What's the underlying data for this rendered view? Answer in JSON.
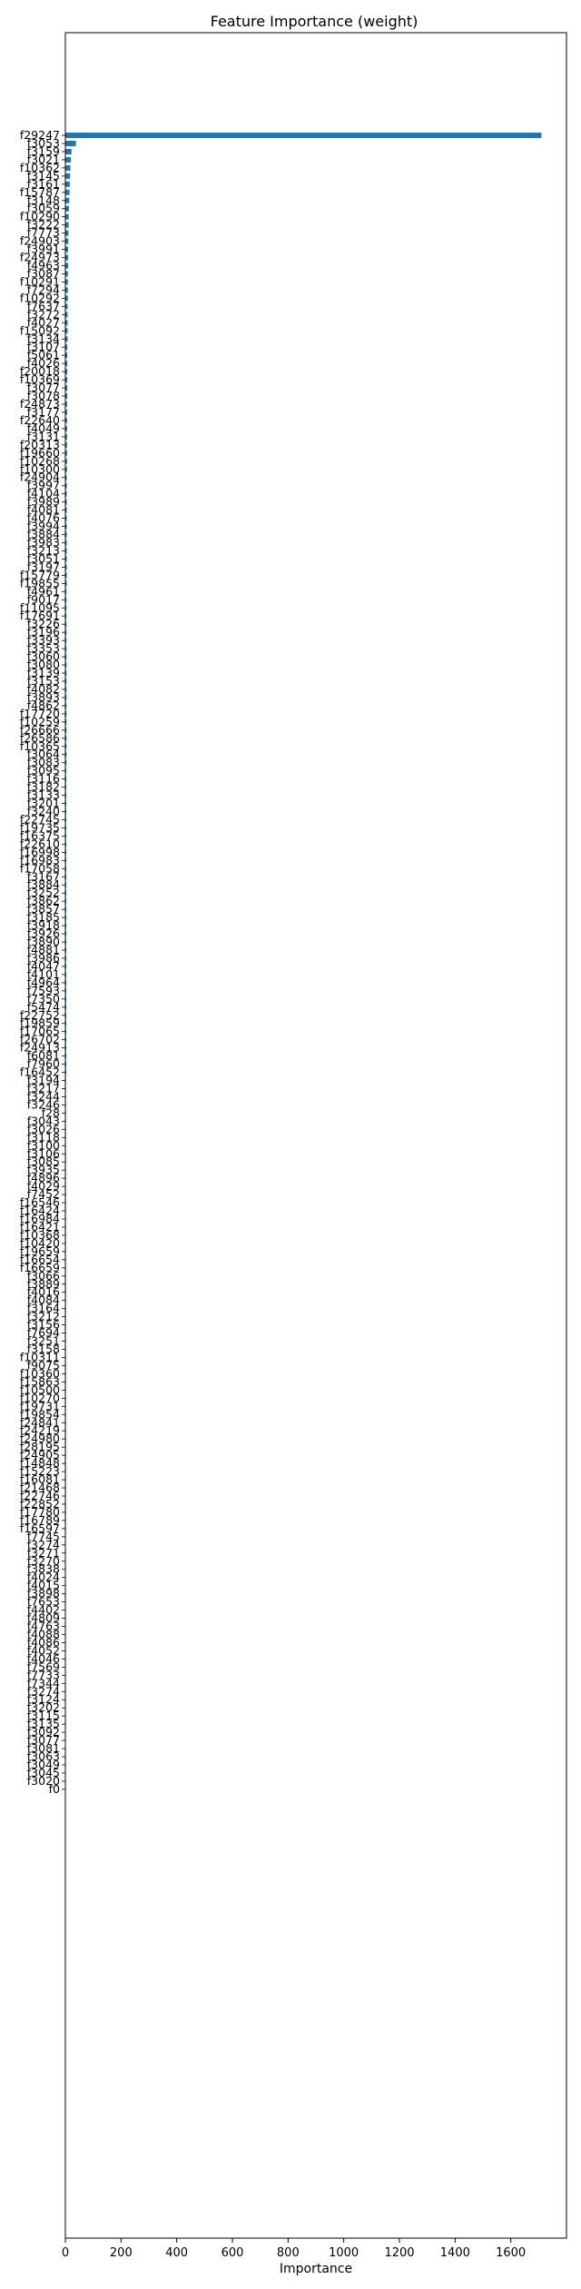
{
  "chart_data": {
    "type": "bar",
    "orientation": "horizontal",
    "title": "Feature Importance (weight)",
    "xlabel": "Importance",
    "ylabel": "",
    "xlim": [
      0,
      1800
    ],
    "xticks": [
      0,
      200,
      400,
      600,
      800,
      1000,
      1200,
      1400,
      1600
    ],
    "grid": false,
    "bar_color": "#1f77b4",
    "categories": [
      "f29247",
      "f3053",
      "f3159",
      "f3021",
      "f10362",
      "f3145",
      "f3161",
      "f15787",
      "f3148",
      "f3059",
      "f10290",
      "f3222",
      "f7773",
      "f24903",
      "f3991",
      "f24973",
      "f4963",
      "f3087",
      "f10291",
      "f7294",
      "f10292",
      "f7637",
      "f3272",
      "f4027",
      "f15092",
      "f3134",
      "f3107",
      "f5061",
      "f4026",
      "f20018",
      "f10369",
      "f3077",
      "f3078",
      "f24873",
      "f3177",
      "f22640",
      "f4049",
      "f3131",
      "f20313",
      "f19660",
      "f10268",
      "f10300",
      "f24904",
      "f3997",
      "f4104",
      "f3989",
      "f4081",
      "f4076",
      "f3994",
      "f3884",
      "f3983",
      "f3213",
      "f3051",
      "f3197",
      "f15779",
      "f19855",
      "f4961",
      "f9017",
      "f11095",
      "f17691",
      "f3226",
      "f3196",
      "f3393",
      "f3353",
      "f3060",
      "f3080",
      "f3139",
      "f3153",
      "f4082",
      "f3893",
      "f4862",
      "f17720",
      "f10259",
      "f26666",
      "f26586",
      "f10365",
      "f3064",
      "f3083",
      "f3095",
      "f3116",
      "f3182",
      "f3133",
      "f3201",
      "f3240",
      "f22745",
      "f19735",
      "f16375",
      "f22610",
      "f16998",
      "f16983",
      "f17058",
      "f3167",
      "f3884",
      "f3252",
      "f3862",
      "f3857",
      "f3185",
      "f3918",
      "f3926",
      "f3890",
      "f4881",
      "f3986",
      "f4047",
      "f4101",
      "f4964",
      "f7593",
      "f7350",
      "f5474",
      "f22752",
      "f19859",
      "f17065",
      "f26702",
      "f24913",
      "f6081",
      "f7960",
      "f16452",
      "f3194",
      "f3217",
      "f3244",
      "f3246",
      "f28",
      "f3043",
      "f3026",
      "f3118",
      "f3100",
      "f3106",
      "f3085",
      "f3935",
      "f4896",
      "f4029",
      "f7452",
      "f16546",
      "f16424",
      "f16984",
      "f16421",
      "f10368",
      "f10420",
      "f19659",
      "f16654",
      "f16659",
      "f3066",
      "f3889",
      "f4016",
      "f4084",
      "f3164",
      "f3212",
      "f3156",
      "f7694",
      "f3251",
      "f3158",
      "f10311",
      "f9075",
      "f10360",
      "f15863",
      "f10500",
      "f10270",
      "f19731",
      "f19854",
      "f24841",
      "f24219",
      "f24980",
      "f28195",
      "f24905",
      "f14848",
      "f15223",
      "f16081",
      "f21468",
      "f22746",
      "f22852",
      "f17780",
      "f16789",
      "f16597",
      "f7745",
      "f3274",
      "f3271",
      "f3270",
      "f3838",
      "f4024",
      "f4015",
      "f3898",
      "f7653",
      "f4402",
      "f4809",
      "f4763",
      "f4088",
      "f4086",
      "f4052",
      "f4046",
      "f7569",
      "f7733",
      "f7344",
      "f3274",
      "f3124",
      "f3202",
      "f3115",
      "f3135",
      "f3092",
      "f3077",
      "f3081",
      "f3063",
      "f3049",
      "f3045",
      "f3020",
      "f0"
    ],
    "values": [
      1710,
      38,
      22,
      20,
      18,
      17,
      16,
      15,
      14,
      13,
      12,
      12,
      11,
      11,
      10,
      10,
      10,
      9,
      9,
      9,
      9,
      8,
      8,
      8,
      8,
      8,
      7,
      7,
      7,
      7,
      7,
      7,
      7,
      6,
      6,
      6,
      6,
      6,
      6,
      6,
      6,
      6,
      5,
      5,
      5,
      5,
      5,
      5,
      5,
      5,
      5,
      5,
      5,
      5,
      5,
      5,
      4,
      4,
      4,
      4,
      4,
      4,
      4,
      4,
      4,
      4,
      4,
      4,
      4,
      4,
      4,
      4,
      4,
      4,
      4,
      4,
      4,
      4,
      3,
      3,
      3,
      3,
      3,
      3,
      3,
      3,
      3,
      3,
      3,
      3,
      3,
      3,
      3,
      3,
      3,
      3,
      3,
      3,
      3,
      3,
      3,
      3,
      3,
      3,
      3,
      3,
      3,
      3,
      3,
      3,
      3,
      3,
      3,
      3,
      3,
      3,
      2,
      2,
      2,
      2,
      2,
      2,
      2,
      2,
      2,
      2,
      2,
      2,
      2,
      2,
      2,
      2,
      2,
      2,
      2,
      2,
      2,
      2,
      2,
      2,
      2,
      2,
      2,
      2,
      2,
      2,
      2,
      2,
      2,
      2,
      2,
      2,
      2,
      2,
      2,
      2,
      2,
      2,
      2,
      2,
      2,
      2,
      2,
      2,
      2,
      2,
      2,
      2,
      2,
      2,
      2,
      2,
      1,
      1,
      1,
      1,
      1,
      1,
      1,
      1,
      1,
      1,
      1,
      1,
      1,
      1,
      1,
      1,
      1,
      1,
      1,
      1,
      1,
      1,
      1,
      1,
      1,
      1,
      1,
      1,
      1,
      1,
      1,
      0
    ]
  }
}
